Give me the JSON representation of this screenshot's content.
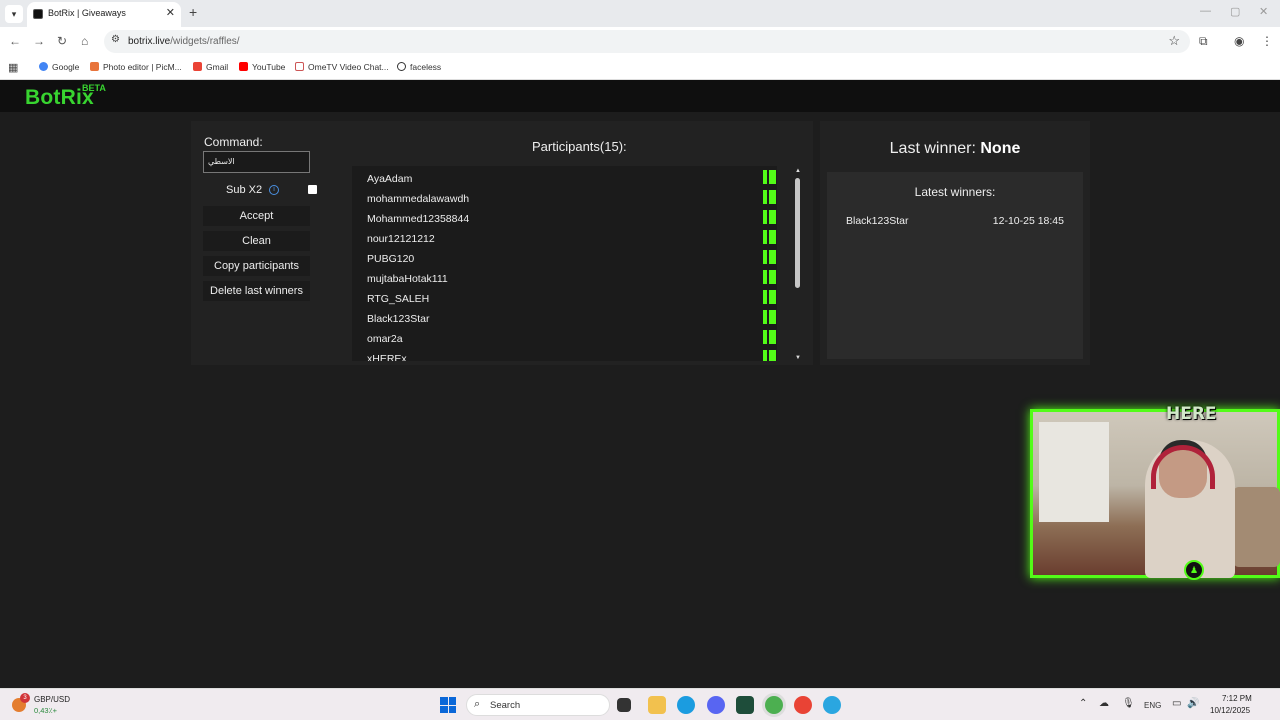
{
  "browser": {
    "tab_title": "BotRix | Giveaways",
    "url_domain": "botrix.live",
    "url_path": "/widgets/raffles/",
    "bookmarks": [
      "Google",
      "Photo editor | PicM...",
      "Gmail",
      "YouTube",
      "OmeTV Video Chat...",
      "faceless"
    ]
  },
  "site": {
    "logo": "BotRix",
    "beta": "BETA"
  },
  "controls": {
    "command_label": "Command:",
    "command_value": "الاسطي",
    "sub_label": "Sub X2",
    "accept": "Accept",
    "clean": "Clean",
    "copy": "Copy participants",
    "delete": "Delete last winners"
  },
  "participants": {
    "title": "Participants(15):",
    "list": [
      "AyaAdam",
      "mohammedalawawdh",
      "Mohammed12358844",
      "nour12121212",
      "PUBG120",
      "mujtabaHotak111",
      "RTG_SALEH",
      "Black123Star",
      "omar2a",
      "xHEREx"
    ]
  },
  "winners": {
    "last_label": "Last winner:",
    "last_value": "None",
    "latest_title": "Latest winners:",
    "entries": [
      {
        "name": "Black123Star",
        "date": "12-10-25 18:45"
      }
    ]
  },
  "overlay": {
    "here_text": "HERE"
  },
  "taskbar": {
    "ticker_name": "GBP/USD",
    "ticker_value": "0,43٪+",
    "weather_badge": "3",
    "search_placeholder": "Search",
    "lang": "ENG",
    "time": "7:12 PM",
    "date": "10/12/2025"
  },
  "colors": {
    "brand_green": "#38d430",
    "kick_green": "#53fc18",
    "panel_bg": "#222222"
  }
}
